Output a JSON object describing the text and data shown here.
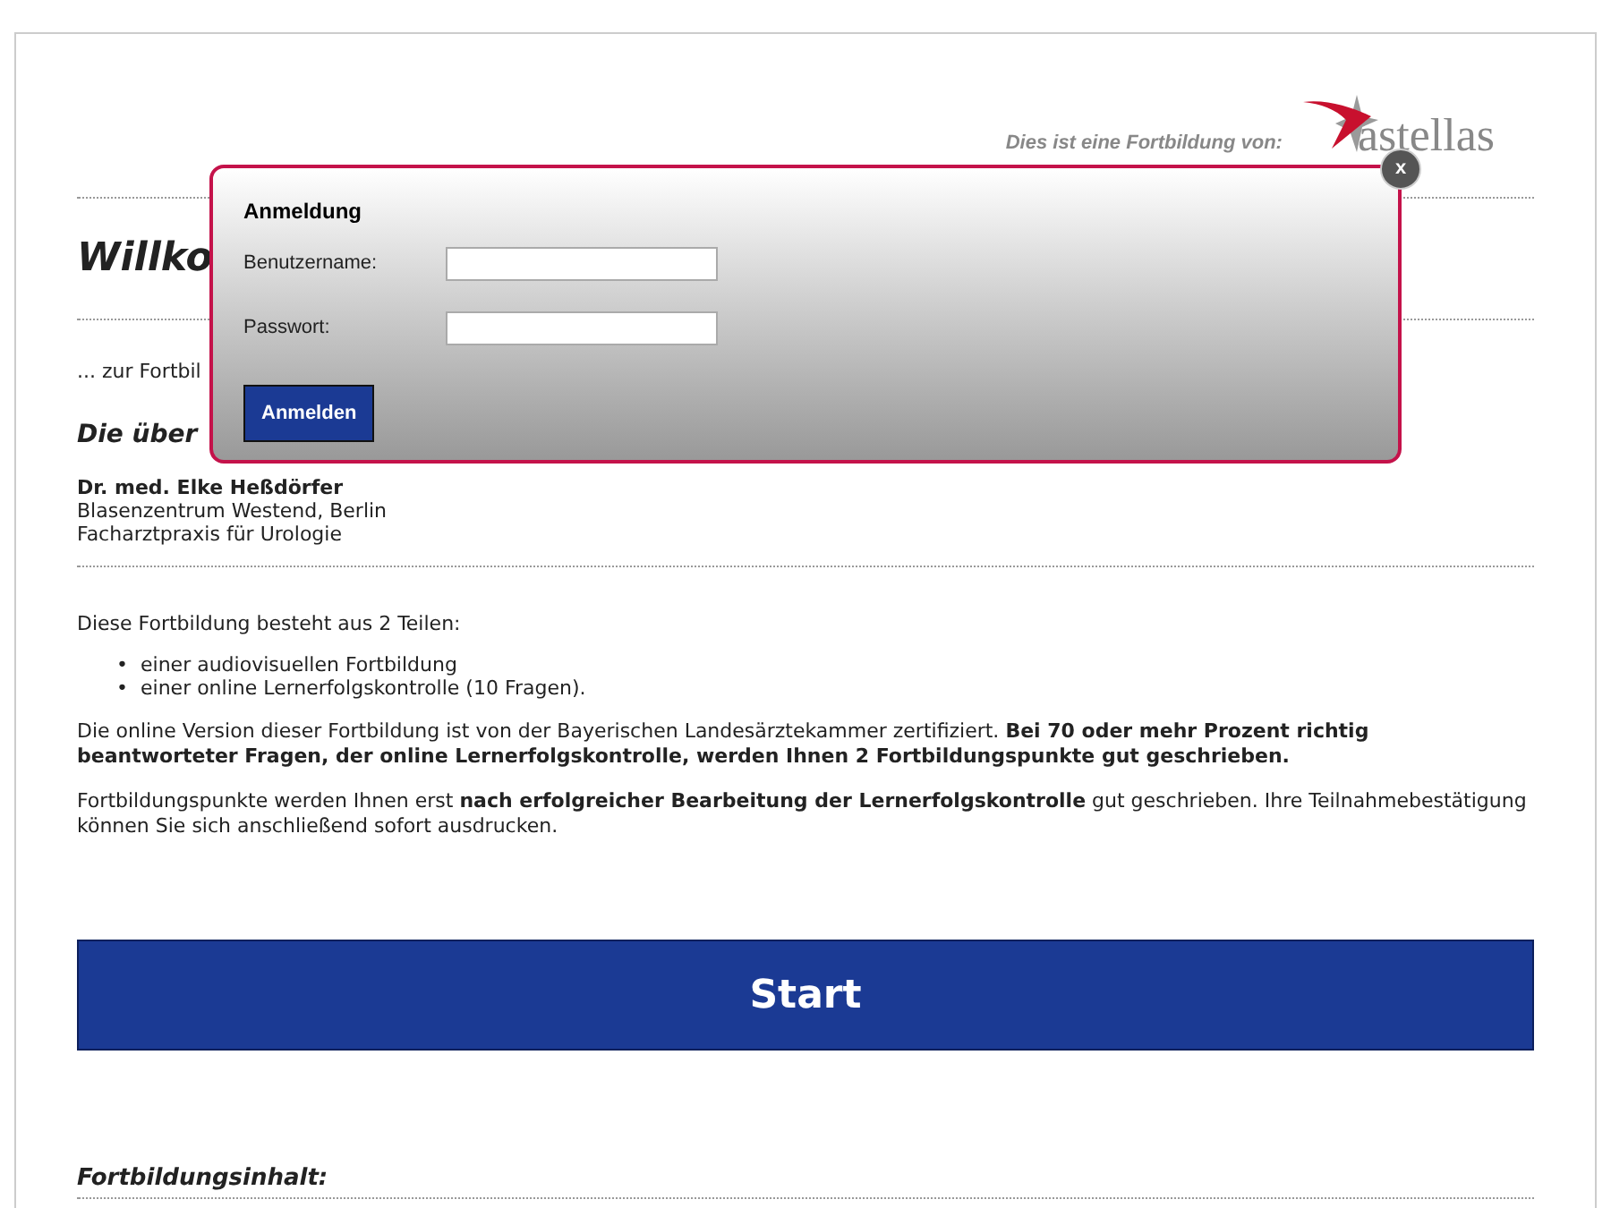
{
  "header": {
    "sponsor_label": "Dies ist eine Fortbildung von:",
    "logo_text": "astellas"
  },
  "title": "Willko",
  "intro": "... zur Fortbil",
  "section_title": "Die über",
  "author": {
    "name": "Dr. med. Elke Heßdörfer",
    "lines": [
      "Blasenzentrum Westend, Berlin",
      "Facharztpraxis für Urologie"
    ]
  },
  "description": "Diese Fortbildung besteht aus 2 Teilen:",
  "parts": [
    {
      "bullet": "•",
      "text": "einer audiovisuellen Fortbildung"
    },
    {
      "bullet": "•",
      "text": "einer online Lernerfolgskontrolle (10 Fragen)."
    }
  ],
  "paragraphs": [
    "Die online Version dieser Fortbildung ist von der Bayerischen Landesärztekammer zertifiziert. **Bei 70 oder mehr Prozent richtig beantworteter Fragen, der online Lernerfolgskontrolle, werden Ihnen 2 Fortbildungspunkte gut geschrieben.**",
    "Fortbildungspunkte werden Ihnen erst **nach erfolgreicher Bearbeitung der Lernerfolgskontrolle** gut geschrieben. Ihre Teilnahmebestätigung können Sie sich anschließend sofort ausdrucken."
  ],
  "start_button": "Start",
  "content_heading": "Fortbildungsinhalt:",
  "login_dialog": {
    "title": "Anmeldung",
    "close": "x",
    "fields": [
      {
        "label": "Benutzername:"
      },
      {
        "label": "Passwort:"
      }
    ],
    "submit": "Anmelden"
  }
}
